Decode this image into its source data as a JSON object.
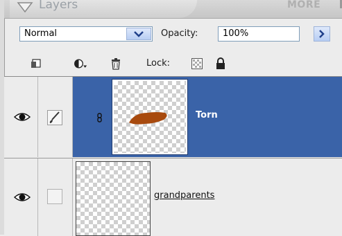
{
  "panel": {
    "title": "Layers",
    "more": "MORE"
  },
  "blend": {
    "mode": "Normal",
    "opacity_label": "Opacity:",
    "opacity_value": "100%"
  },
  "lock": {
    "label": "Lock:"
  },
  "layers": [
    {
      "name": "Torn",
      "selected": true
    },
    {
      "name": "grandparents",
      "selected": false
    }
  ],
  "colors": {
    "selection": "#3a63a8",
    "paint_stroke": "#a84a0e"
  }
}
